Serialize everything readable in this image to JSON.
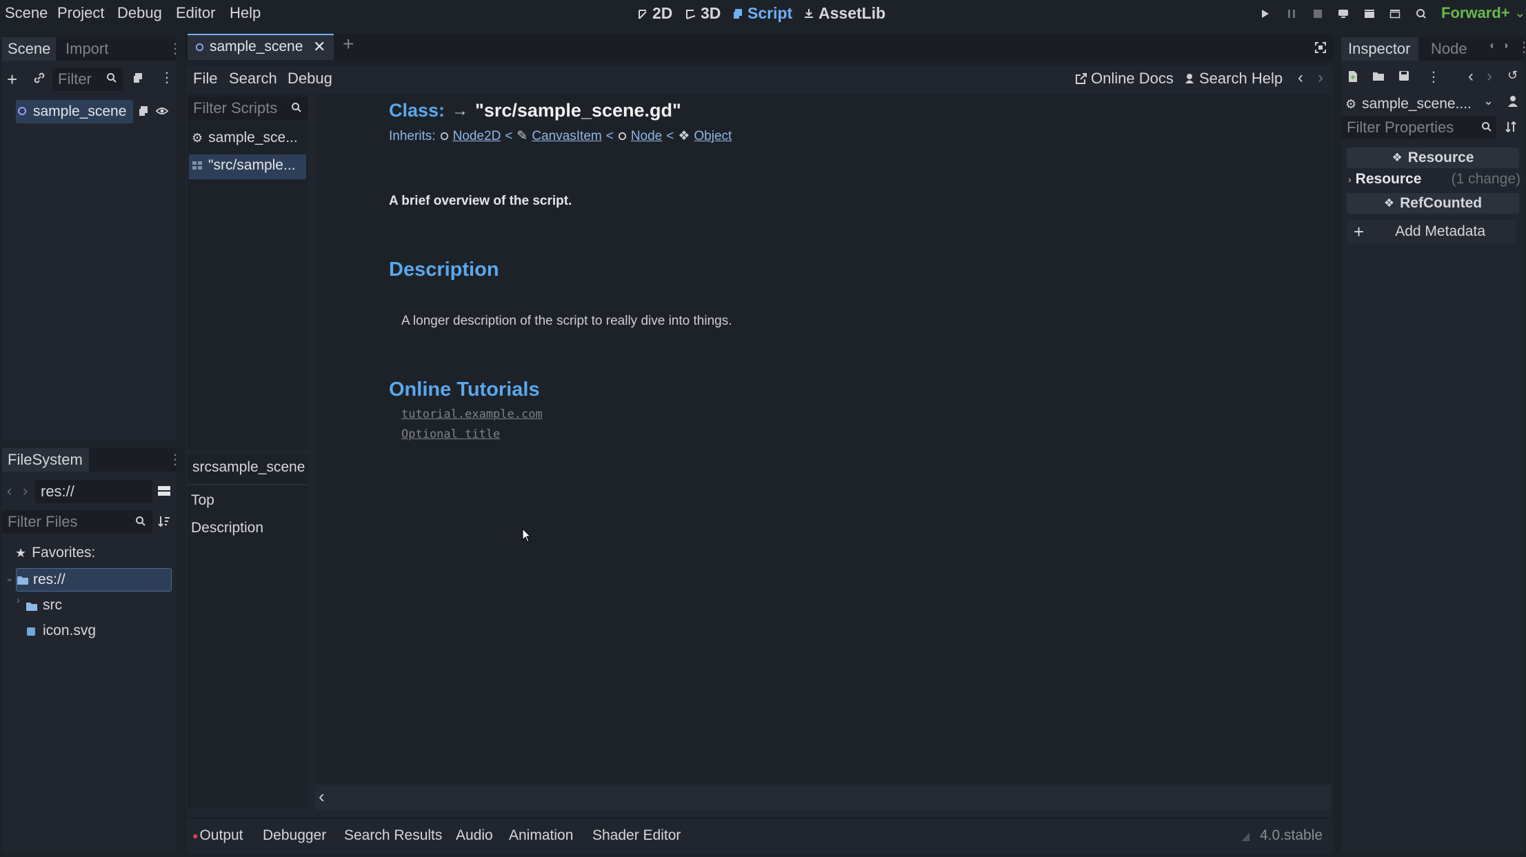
{
  "menu": [
    "Scene",
    "Project",
    "Debug",
    "Editor",
    "Help"
  ],
  "workspaces": [
    {
      "label": "2D",
      "icon": "2d-icon"
    },
    {
      "label": "3D",
      "icon": "3d-icon"
    },
    {
      "label": "Script",
      "icon": "script-icon",
      "active": true
    },
    {
      "label": "AssetLib",
      "icon": "assetlib-icon"
    }
  ],
  "renderer": "Forward+",
  "scene_dock": {
    "tabs": [
      "Scene",
      "Import"
    ],
    "filter_placeholder": "Filter",
    "root_node": "sample_scene"
  },
  "filesystem_dock": {
    "title": "FileSystem",
    "path": "res://",
    "filter_placeholder": "Filter Files",
    "favorites": "Favorites:",
    "root": "res://",
    "items": [
      "src",
      "icon.svg"
    ]
  },
  "script_editor": {
    "open_tab": "sample_scene",
    "menu": [
      "File",
      "Search",
      "Debug"
    ],
    "online_docs": "Online Docs",
    "search_help": "Search Help",
    "filter_scripts_placeholder": "Filter Scripts",
    "script_list": [
      "sample_sce...",
      "\"src/sample..."
    ],
    "outline_title": "srcsample_scene",
    "outline_items": [
      "Top",
      "Description"
    ]
  },
  "doc": {
    "class_label": "Class:",
    "class_name": "\"src/sample_scene.gd\"",
    "inherits_label": "Inherits:",
    "inherits": [
      "Node2D",
      "CanvasItem",
      "Node",
      "Object"
    ],
    "brief": "A brief overview of the script.",
    "description_heading": "Description",
    "description": "A longer description of the script to really dive into things.",
    "tutorials_heading": "Online Tutorials",
    "tutorials": [
      "tutorial.example.com",
      "Optional title"
    ]
  },
  "bottom_panel": {
    "tabs": [
      "Output",
      "Debugger",
      "Search Results",
      "Audio",
      "Animation",
      "Shader Editor"
    ],
    "version": "4.0.stable"
  },
  "inspector": {
    "tabs": [
      "Inspector",
      "Node"
    ],
    "resource_selector": "sample_scene....",
    "filter_placeholder": "Filter Properties",
    "section_resource": "Resource",
    "resource_row_label": "Resource",
    "resource_row_changes": "(1 change)",
    "section_refcounted": "RefCounted",
    "add_metadata": "Add Metadata"
  },
  "colors": {
    "accent": "#6fb0f5",
    "heading": "#5aa8ec",
    "renderer": "#69b94c",
    "output_dot": "#e0464e"
  }
}
